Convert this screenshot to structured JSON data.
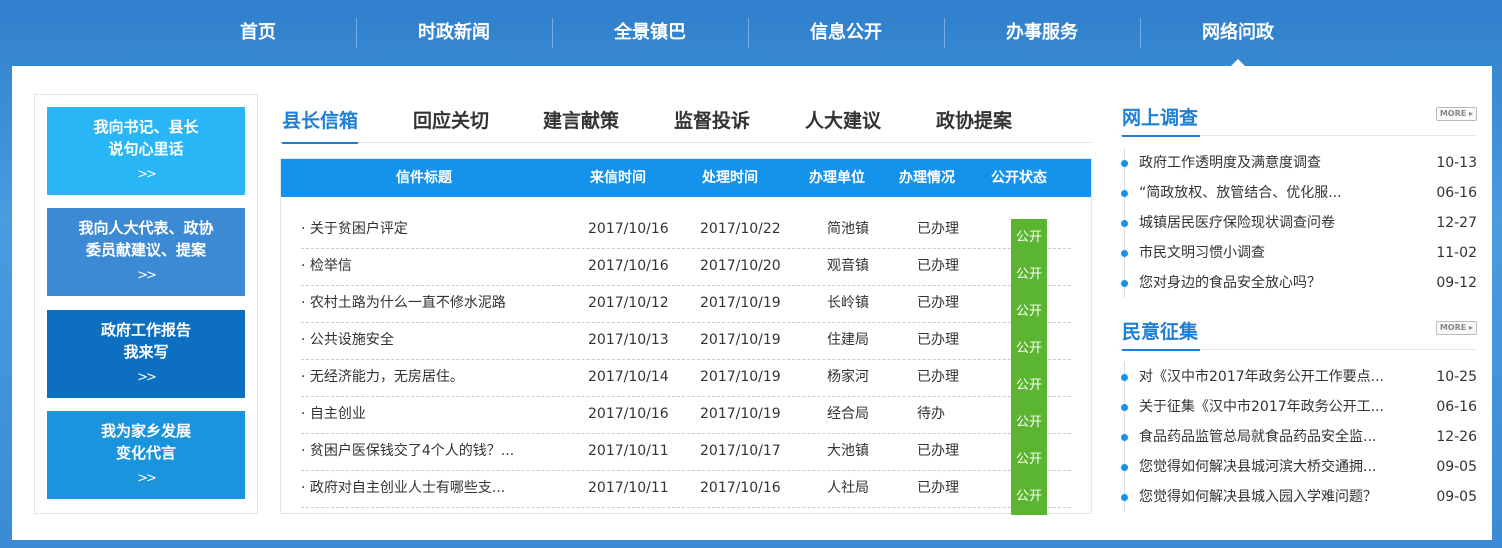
{
  "nav": [
    "首页",
    "时政新闻",
    "全景镇巴",
    "信息公开",
    "办事服务",
    "网络问政"
  ],
  "left_buttons": [
    {
      "line1": "我向书记、县长",
      "line2": "说句心里话",
      "arrows": ">>",
      "color": "#29b6f6"
    },
    {
      "line1": "我向人大代表、政协",
      "line2": "委员献建议、提案",
      "arrows": ">>",
      "color": "#3c8ad4"
    },
    {
      "line1": "政府工作报告",
      "line2": "我来写",
      "arrows": ">>",
      "color": "#0c6fc0"
    },
    {
      "line1": "我为家乡发展",
      "line2": "变化代言",
      "arrows": ">>",
      "color": "#1a94dc"
    }
  ],
  "tabs": [
    "县长信箱",
    "回应关切",
    "建言献策",
    "监督投诉",
    "人大建议",
    "政协提案"
  ],
  "table": {
    "headers": [
      "信件标题",
      "来信时间",
      "处理时间",
      "办理单位",
      "办理情况",
      "公开状态"
    ],
    "rows": [
      [
        "· 关于贫困户评定",
        "2017/10/16",
        "2017/10/22",
        "简池镇",
        "已办理",
        "公开"
      ],
      [
        "· 检举信",
        "2017/10/16",
        "2017/10/20",
        "观音镇",
        "已办理",
        "公开"
      ],
      [
        "· 农村土路为什么一直不修水泥路",
        "2017/10/12",
        "2017/10/19",
        "长岭镇",
        "已办理",
        "公开"
      ],
      [
        "· 公共设施安全",
        "2017/10/13",
        "2017/10/19",
        "住建局",
        "已办理",
        "公开"
      ],
      [
        "· 无经济能力，无房居住。",
        "2017/10/14",
        "2017/10/19",
        "杨家河",
        "已办理",
        "公开"
      ],
      [
        "· 自主创业",
        "2017/10/16",
        "2017/10/19",
        "经合局",
        "待办",
        "公开"
      ],
      [
        "· 贫困户医保钱交了4个人的钱？...",
        "2017/10/11",
        "2017/10/17",
        "大池镇",
        "已办理",
        "公开"
      ],
      [
        "· 政府对自主创业人士有哪些支...",
        "2017/10/11",
        "2017/10/16",
        "人社局",
        "已办理",
        "公开"
      ]
    ]
  },
  "survey": {
    "title": "网上调查",
    "more": "MORE ▸",
    "items": [
      {
        "text": "政府工作透明度及满意度调查",
        "date": "10-13"
      },
      {
        "text": "“简政放权、放管结合、优化服...",
        "date": "06-16"
      },
      {
        "text": "城镇居民医疗保险现状调查问卷",
        "date": "12-27"
      },
      {
        "text": "市民文明习惯小调查",
        "date": "11-02"
      },
      {
        "text": "您对身边的食品安全放心吗？",
        "date": "09-12"
      }
    ]
  },
  "opinion": {
    "title": "民意征集",
    "more": "MORE ▸",
    "items": [
      {
        "text": "对《汉中市2017年政务公开工作要点...",
        "date": "10-25"
      },
      {
        "text": "关于征集《汉中市2017年政务公开工...",
        "date": "06-16"
      },
      {
        "text": "食品药品监管总局就食品药品安全监...",
        "date": "12-26"
      },
      {
        "text": "您觉得如何解决县城河滨大桥交通拥...",
        "date": "09-05"
      },
      {
        "text": "您觉得如何解决县城入园入学难问题？",
        "date": "09-05"
      }
    ]
  }
}
